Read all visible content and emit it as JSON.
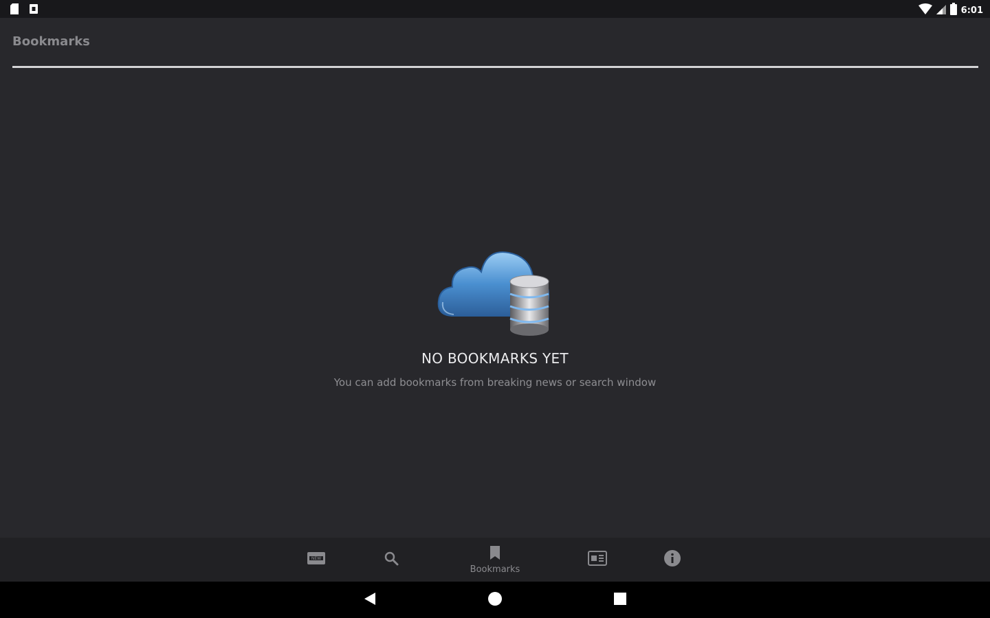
{
  "status_bar": {
    "time": "6:01",
    "icons": [
      "sd-card-icon",
      "notification-icon",
      "wifi-icon",
      "signal-icon",
      "battery-icon"
    ]
  },
  "header": {
    "title": "Bookmarks"
  },
  "empty_state": {
    "illustration": "cloud-database-icon",
    "title": "NO BOOKMARKS YET",
    "subtitle": "You can add bookmarks from breaking news or search window"
  },
  "bottom_nav": {
    "items": [
      {
        "icon": "news-icon",
        "label": ""
      },
      {
        "icon": "search-icon",
        "label": ""
      },
      {
        "icon": "bookmark-icon",
        "label": "Bookmarks",
        "active": true
      },
      {
        "icon": "newspaper-icon",
        "label": ""
      },
      {
        "icon": "info-icon",
        "label": ""
      }
    ]
  },
  "system_nav": {
    "buttons": [
      "back-icon",
      "home-icon",
      "recents-icon"
    ]
  },
  "colors": {
    "background": "#28282c",
    "status_bar": "#18181b",
    "bottom_nav": "#212124",
    "title_text": "#8a8a8e",
    "divider": "#d4d4d6",
    "cloud_blue": "#4a8fd0"
  }
}
